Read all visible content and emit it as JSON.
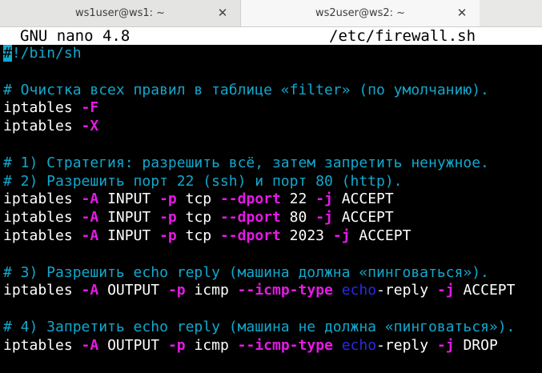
{
  "tabs": [
    {
      "title": "ws1user@ws1: ~",
      "close": "✕"
    },
    {
      "title": "ws2user@ws2: ~",
      "close": "✕"
    }
  ],
  "nano": {
    "app": "GNU nano 4.8",
    "file": "/etc/firewall.sh"
  },
  "lines": [
    [
      {
        "t": "#",
        "c": "cursor"
      },
      {
        "t": "!/bin/sh",
        "c": "cmt"
      }
    ],
    [],
    [
      {
        "t": "# Очистка всех правил в таблице «filter» (по умолчанию).",
        "c": "cmt"
      }
    ],
    [
      {
        "t": "iptables ",
        "c": "txt"
      },
      {
        "t": "-F",
        "c": "flag"
      }
    ],
    [
      {
        "t": "iptables ",
        "c": "txt"
      },
      {
        "t": "-X",
        "c": "flag"
      }
    ],
    [],
    [
      {
        "t": "# 1) Стратегия: разрешить всё, затем запретить ненужное.",
        "c": "cmt"
      }
    ],
    [
      {
        "t": "# 2) Разрешить порт 22 (ssh) и порт 80 (http).",
        "c": "cmt"
      }
    ],
    [
      {
        "t": "iptables ",
        "c": "txt"
      },
      {
        "t": "-A",
        "c": "flag"
      },
      {
        "t": " INPUT ",
        "c": "txt"
      },
      {
        "t": "-p",
        "c": "flag"
      },
      {
        "t": " tcp ",
        "c": "txt"
      },
      {
        "t": "--dport",
        "c": "flag"
      },
      {
        "t": " 22 ",
        "c": "txt"
      },
      {
        "t": "-j",
        "c": "flag"
      },
      {
        "t": " ACCEPT",
        "c": "txt"
      }
    ],
    [
      {
        "t": "iptables ",
        "c": "txt"
      },
      {
        "t": "-A",
        "c": "flag"
      },
      {
        "t": " INPUT ",
        "c": "txt"
      },
      {
        "t": "-p",
        "c": "flag"
      },
      {
        "t": " tcp ",
        "c": "txt"
      },
      {
        "t": "--dport",
        "c": "flag"
      },
      {
        "t": " 80 ",
        "c": "txt"
      },
      {
        "t": "-j",
        "c": "flag"
      },
      {
        "t": " ACCEPT",
        "c": "txt"
      }
    ],
    [
      {
        "t": "iptables ",
        "c": "txt"
      },
      {
        "t": "-A",
        "c": "flag"
      },
      {
        "t": " INPUT ",
        "c": "txt"
      },
      {
        "t": "-p",
        "c": "flag"
      },
      {
        "t": " tcp ",
        "c": "txt"
      },
      {
        "t": "--dport",
        "c": "flag"
      },
      {
        "t": " 2023 ",
        "c": "txt"
      },
      {
        "t": "-j",
        "c": "flag"
      },
      {
        "t": " ACCEPT",
        "c": "txt"
      }
    ],
    [],
    [
      {
        "t": "# 3) Разрешить echo reply (машина должна «пинговаться»).",
        "c": "cmt"
      }
    ],
    [
      {
        "t": "iptables ",
        "c": "txt"
      },
      {
        "t": "-A",
        "c": "flag"
      },
      {
        "t": " OUTPUT ",
        "c": "txt"
      },
      {
        "t": "-p",
        "c": "flag"
      },
      {
        "t": " icmp ",
        "c": "txt"
      },
      {
        "t": "--icmp-type",
        "c": "flag"
      },
      {
        "t": " ",
        "c": "txt"
      },
      {
        "t": "echo",
        "c": "kw"
      },
      {
        "t": "-reply ",
        "c": "txt"
      },
      {
        "t": "-j",
        "c": "flag"
      },
      {
        "t": " ACCEPT",
        "c": "txt"
      }
    ],
    [],
    [
      {
        "t": "# 4) Запретить echo reply (машина не должна «пинговаться»).",
        "c": "cmt"
      }
    ],
    [
      {
        "t": "iptables ",
        "c": "txt"
      },
      {
        "t": "-A",
        "c": "flag"
      },
      {
        "t": " OUTPUT ",
        "c": "txt"
      },
      {
        "t": "-p",
        "c": "flag"
      },
      {
        "t": " icmp ",
        "c": "txt"
      },
      {
        "t": "--icmp-type",
        "c": "flag"
      },
      {
        "t": " ",
        "c": "txt"
      },
      {
        "t": "echo",
        "c": "kw"
      },
      {
        "t": "-reply ",
        "c": "txt"
      },
      {
        "t": "-j",
        "c": "flag"
      },
      {
        "t": " DROP",
        "c": "txt"
      }
    ]
  ],
  "colors": {
    "comment": "#11a8cd",
    "flag": "#e619e6",
    "keyword": "#2a2ae6",
    "text": "#ffffff",
    "background": "#000000"
  }
}
